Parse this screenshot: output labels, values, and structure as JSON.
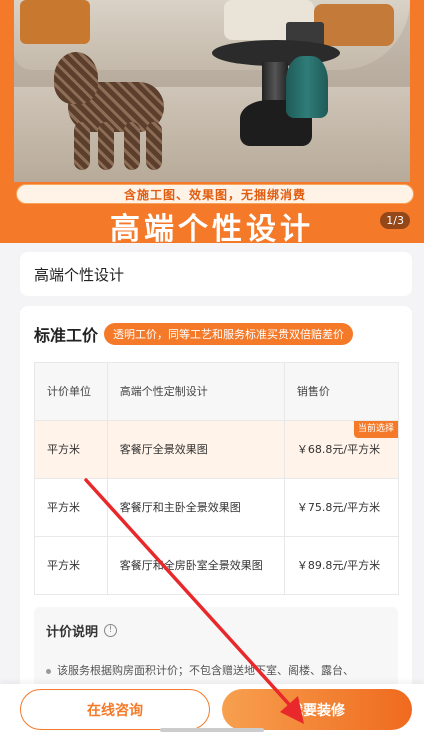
{
  "banner": {
    "tagline": "含施工图、效果图，无捆绑消费",
    "title": "高端个性设计",
    "page_indicator": "1/3"
  },
  "product": {
    "name": "高端个性设计"
  },
  "pricing": {
    "heading": "标准工价",
    "badge": "透明工价，同等工艺和服务标准买贵双倍赔差价",
    "columns": [
      "计价单位",
      "高端个性定制设计",
      "销售价"
    ],
    "current_tag": "当前选择",
    "rows": [
      {
        "unit": "平方米",
        "item": "客餐厅全景效果图",
        "price": "￥68.8元/平方米"
      },
      {
        "unit": "平方米",
        "item": "客餐厅和主卧全景效果图",
        "price": "￥75.8元/平方米"
      },
      {
        "unit": "平方米",
        "item": "客餐厅和全房卧室全景效果图",
        "price": "￥89.8元/平方米"
      }
    ]
  },
  "note": {
    "title": "计价说明",
    "info_icon_glyph": "!",
    "item": "该服务根据购房面积计价；不包含赠送地下室、阁楼、露台、"
  },
  "actions": {
    "consult_label": "在线咨询",
    "decorate_label": "我要装修"
  },
  "colors": {
    "accent": "#f47a2a",
    "annotation": "#e8282a"
  },
  "icons": {
    "info": "info-icon"
  }
}
